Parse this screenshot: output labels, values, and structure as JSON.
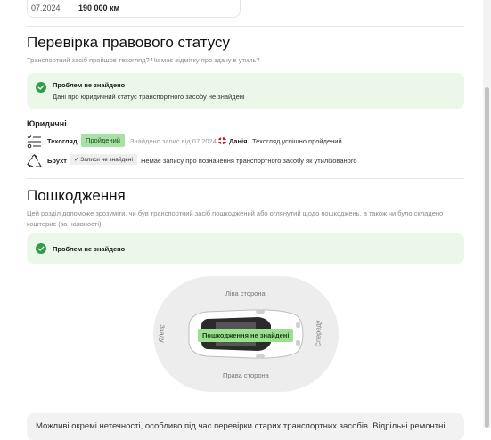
{
  "top_card": {
    "date": "07.2024",
    "mileage": "190 000 км"
  },
  "legal": {
    "title": "Перевірка правового статусу",
    "subtitle": "Транспортний засіб пройшов техогляд? Чи має відмітку про здачу в утиль?",
    "status_title": "Проблем не знайдено",
    "status_text": "Дані про юридичний статус транспортного засобу не знайдені",
    "group_heading": "Юридичні",
    "inspection": {
      "label": "Техогляд",
      "badge": "Пройдений",
      "found_text": "Знайдено запис від 07.2024",
      "country": "Данія",
      "result": "Техогляд успішно пройдений"
    },
    "scrap": {
      "label": "Брухт",
      "badge": "Записи не знайдені",
      "result": "Немає запису про позначення транспортного засобу як утилізованого"
    }
  },
  "damage": {
    "title": "Пошкодження",
    "subtitle_line1": "Цей розділ допоможе зрозуміти, чи був транспортний засіб пошкоджений або оглянутий щодо пошкоджень, а також чи було складено",
    "subtitle_line2": "кошторис (за наявності).",
    "status_title": "Проблем не знайдено",
    "diagram": {
      "left_side": "Ліва сторона",
      "right_side": "Права сторона",
      "rear": "Ззаду",
      "front": "Спереду",
      "result": "Пошкодження не знайдені"
    }
  },
  "bottom_note": "Можливі окремі нетечності, особливо під час перевірки старих транспортних засобів. Відрільні ремонтні"
}
